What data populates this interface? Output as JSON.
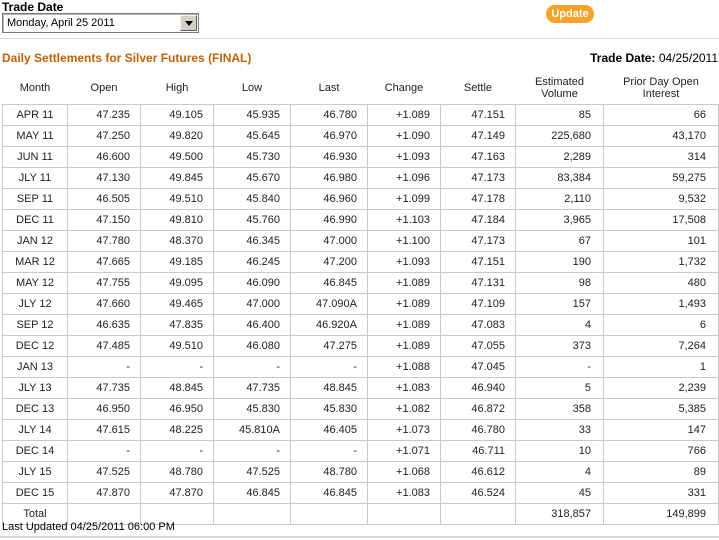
{
  "controls": {
    "trade_date_label": "Trade Date",
    "trade_date_dropdown_value": "Monday, April 25 2011",
    "update_button_label": "Update"
  },
  "header": {
    "title": "Daily Settlements for Silver Futures (FINAL)",
    "trade_date_label": "Trade Date:",
    "trade_date_value": "04/25/2011"
  },
  "table": {
    "columns": [
      "Month",
      "Open",
      "High",
      "Low",
      "Last",
      "Change",
      "Settle",
      "Estimated Volume",
      "Prior Day Open Interest"
    ],
    "column_keys": [
      "month",
      "open",
      "high",
      "low",
      "last",
      "change",
      "settle",
      "volume",
      "oi"
    ],
    "rows": [
      [
        "APR 11",
        "47.235",
        "49.105",
        "45.935",
        "46.780",
        "+1.089",
        "47.151",
        "85",
        "66"
      ],
      [
        "MAY 11",
        "47.250",
        "49.820",
        "45.645",
        "46.970",
        "+1.090",
        "47.149",
        "225,680",
        "43,170"
      ],
      [
        "JUN 11",
        "46.600",
        "49.500",
        "45.730",
        "46.930",
        "+1.093",
        "47.163",
        "2,289",
        "314"
      ],
      [
        "JLY 11",
        "47.130",
        "49.845",
        "45.670",
        "46.980",
        "+1.096",
        "47.173",
        "83,384",
        "59,275"
      ],
      [
        "SEP 11",
        "46.505",
        "49.510",
        "45.840",
        "46.960",
        "+1.099",
        "47.178",
        "2,110",
        "9,532"
      ],
      [
        "DEC 11",
        "47.150",
        "49.810",
        "45.760",
        "46.990",
        "+1.103",
        "47.184",
        "3,965",
        "17,508"
      ],
      [
        "JAN 12",
        "47.780",
        "48.370",
        "46.345",
        "47.000",
        "+1.100",
        "47.173",
        "67",
        "101"
      ],
      [
        "MAR 12",
        "47.665",
        "49.185",
        "46.245",
        "47.200",
        "+1.093",
        "47.151",
        "190",
        "1,732"
      ],
      [
        "MAY 12",
        "47.755",
        "49.095",
        "46.090",
        "46.845",
        "+1.089",
        "47.131",
        "98",
        "480"
      ],
      [
        "JLY 12",
        "47.660",
        "49.465",
        "47.000",
        "47.090A",
        "+1.089",
        "47.109",
        "157",
        "1,493"
      ],
      [
        "SEP 12",
        "46.635",
        "47.835",
        "46.400",
        "46.920A",
        "+1.089",
        "47.083",
        "4",
        "6"
      ],
      [
        "DEC 12",
        "47.485",
        "49.510",
        "46.080",
        "47.275",
        "+1.089",
        "47.055",
        "373",
        "7,264"
      ],
      [
        "JAN 13",
        "-",
        "-",
        "-",
        "-",
        "+1.088",
        "47.045",
        "-",
        "1"
      ],
      [
        "JLY 13",
        "47.735",
        "48.845",
        "47.735",
        "48.845",
        "+1.083",
        "46.940",
        "5",
        "2,239"
      ],
      [
        "DEC 13",
        "46.950",
        "46.950",
        "45.830",
        "45.830",
        "+1.082",
        "46.872",
        "358",
        "5,385"
      ],
      [
        "JLY 14",
        "47.615",
        "48.225",
        "45.810A",
        "46.405",
        "+1.073",
        "46.780",
        "33",
        "147"
      ],
      [
        "DEC 14",
        "-",
        "-",
        "-",
        "-",
        "+1.071",
        "46.711",
        "10",
        "766"
      ],
      [
        "JLY 15",
        "47.525",
        "48.780",
        "47.525",
        "48.780",
        "+1.068",
        "46.612",
        "4",
        "89"
      ],
      [
        "DEC 15",
        "47.870",
        "47.870",
        "46.845",
        "46.845",
        "+1.083",
        "46.524",
        "45",
        "331"
      ]
    ],
    "total_row": [
      "Total",
      "",
      "",
      "",
      "",
      "",
      "",
      "318,857",
      "149,899"
    ]
  },
  "footer": {
    "last_updated": "Last Updated 04/25/2011 06:00 PM"
  }
}
